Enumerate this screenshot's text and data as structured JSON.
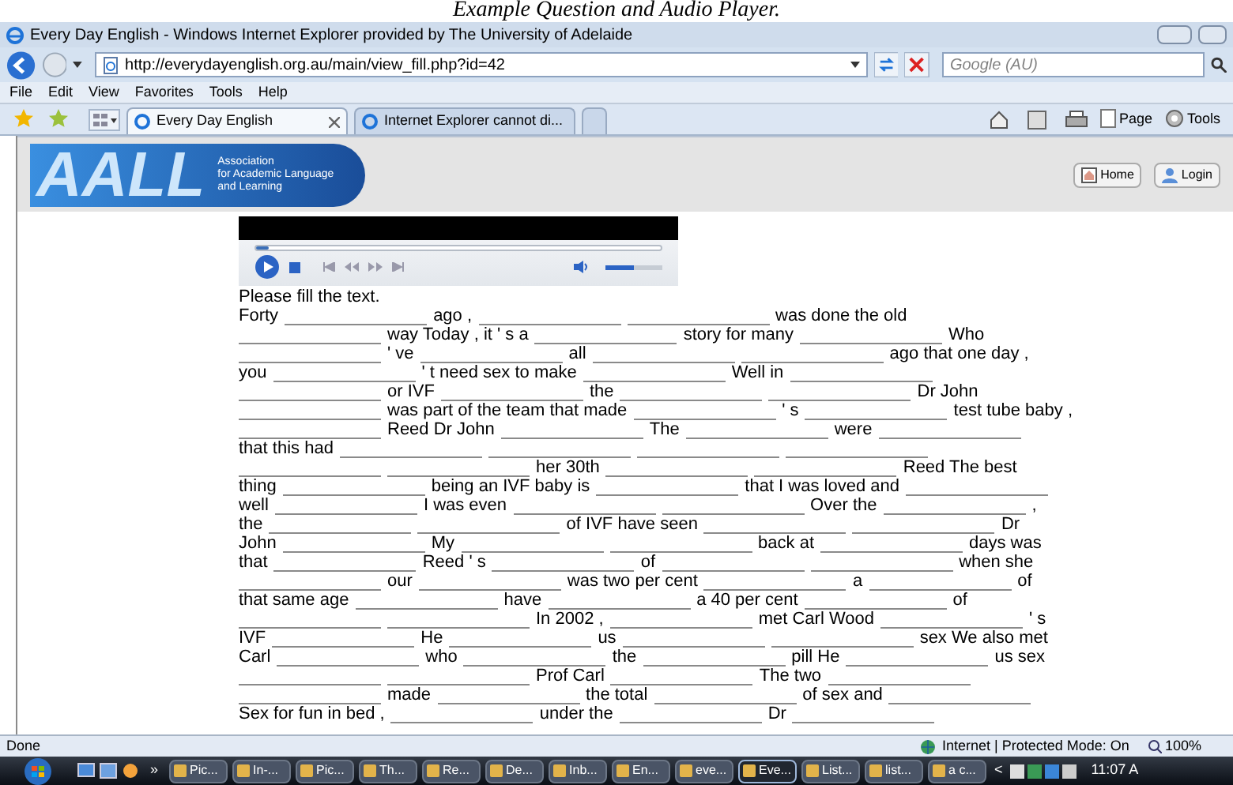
{
  "caption": "Example Question and Audio Player.",
  "window": {
    "title": "Every Day English - Windows Internet Explorer provided by The University of Adelaide"
  },
  "address_bar": {
    "url": "http://everydayenglish.org.au/main/view_fill.php?id=42"
  },
  "search": {
    "placeholder": "Google (AU)"
  },
  "menu": [
    "File",
    "Edit",
    "View",
    "Favorites",
    "Tools",
    "Help"
  ],
  "tabs": [
    {
      "label": "Every Day English",
      "selected": true
    },
    {
      "label": "Internet Explorer cannot di...",
      "selected": false
    }
  ],
  "command_bar": [
    "Page",
    "Tools"
  ],
  "header": {
    "logo": "AALL",
    "logo_lines": [
      "Association",
      "for Academic Language",
      "and Learning"
    ],
    "buttons": [
      "Home",
      "Login"
    ]
  },
  "player": {
    "seek": {
      "level": 0.02
    },
    "volume": {
      "level": 0.5
    }
  },
  "instruction": "Please fill the text.",
  "passage": [
    [
      {
        "kind": "text",
        "text": "Forty"
      },
      {
        "kind": "blank"
      },
      {
        "kind": "text",
        "text": "ago ,"
      },
      {
        "kind": "blank"
      },
      {
        "kind": "blank"
      },
      {
        "kind": "text",
        "text": "was done the old"
      }
    ],
    [
      {
        "kind": "blank"
      },
      {
        "kind": "text",
        "text": "way Today , it ' s a"
      },
      {
        "kind": "blank"
      },
      {
        "kind": "text",
        "text": "story for many"
      },
      {
        "kind": "blank"
      },
      {
        "kind": "text",
        "text": "Who"
      }
    ],
    [
      {
        "kind": "blank"
      },
      {
        "kind": "text",
        "text": "' ve"
      },
      {
        "kind": "blank"
      },
      {
        "kind": "text",
        "text": "all"
      },
      {
        "kind": "blank"
      },
      {
        "kind": "blank"
      },
      {
        "kind": "text",
        "text": "ago that one day ,"
      }
    ],
    [
      {
        "kind": "text",
        "text": "you"
      },
      {
        "kind": "blank"
      },
      {
        "kind": "text",
        "text": "' t need sex to make"
      },
      {
        "kind": "blank"
      },
      {
        "kind": "text",
        "text": "Well in"
      },
      {
        "kind": "blank"
      }
    ],
    [
      {
        "kind": "blank"
      },
      {
        "kind": "text",
        "text": "or IVF"
      },
      {
        "kind": "blank"
      },
      {
        "kind": "text",
        "text": "the"
      },
      {
        "kind": "blank"
      },
      {
        "kind": "blank"
      },
      {
        "kind": "text",
        "text": "Dr John"
      }
    ],
    [
      {
        "kind": "blank"
      },
      {
        "kind": "text",
        "text": "was part of the team that made"
      },
      {
        "kind": "blank"
      },
      {
        "kind": "text",
        "text": "' s"
      },
      {
        "kind": "blank"
      },
      {
        "kind": "text",
        "text": "test tube baby ,"
      }
    ],
    [
      {
        "kind": "blank"
      },
      {
        "kind": "text",
        "text": "Reed Dr John"
      },
      {
        "kind": "blank"
      },
      {
        "kind": "text",
        "text": "The"
      },
      {
        "kind": "blank"
      },
      {
        "kind": "text",
        "text": "were"
      },
      {
        "kind": "blank"
      }
    ],
    [
      {
        "kind": "text",
        "text": "that this had"
      },
      {
        "kind": "blank"
      },
      {
        "kind": "blank"
      },
      {
        "kind": "blank"
      },
      {
        "kind": "blank"
      }
    ],
    [
      {
        "kind": "blank"
      },
      {
        "kind": "blank"
      },
      {
        "kind": "text",
        "text": "her 30th"
      },
      {
        "kind": "blank"
      },
      {
        "kind": "blank"
      },
      {
        "kind": "text",
        "text": "Reed The best"
      }
    ],
    [
      {
        "kind": "text",
        "text": "thing"
      },
      {
        "kind": "blank"
      },
      {
        "kind": "text",
        "text": "being an IVF baby is"
      },
      {
        "kind": "blank"
      },
      {
        "kind": "text",
        "text": "that I was loved and"
      },
      {
        "kind": "blank"
      }
    ],
    [
      {
        "kind": "text",
        "text": "well"
      },
      {
        "kind": "blank"
      },
      {
        "kind": "text",
        "text": "I was even"
      },
      {
        "kind": "blank"
      },
      {
        "kind": "blank"
      },
      {
        "kind": "text",
        "text": "Over the"
      },
      {
        "kind": "blank"
      },
      {
        "kind": "text",
        "text": ","
      }
    ],
    [
      {
        "kind": "text",
        "text": "the"
      },
      {
        "kind": "blank"
      },
      {
        "kind": "blank"
      },
      {
        "kind": "text",
        "text": "of IVF have seen"
      },
      {
        "kind": "blank"
      },
      {
        "kind": "blank"
      },
      {
        "kind": "text",
        "text": "Dr"
      }
    ],
    [
      {
        "kind": "text",
        "text": "John"
      },
      {
        "kind": "blank"
      },
      {
        "kind": "text",
        "text": "My"
      },
      {
        "kind": "blank"
      },
      {
        "kind": "blank"
      },
      {
        "kind": "text",
        "text": "back at"
      },
      {
        "kind": "blank"
      },
      {
        "kind": "text",
        "text": "days was"
      }
    ],
    [
      {
        "kind": "text",
        "text": "that"
      },
      {
        "kind": "blank"
      },
      {
        "kind": "text",
        "text": "Reed ' s"
      },
      {
        "kind": "blank"
      },
      {
        "kind": "text",
        "text": "of"
      },
      {
        "kind": "blank"
      },
      {
        "kind": "blank"
      },
      {
        "kind": "text",
        "text": "when she"
      }
    ],
    [
      {
        "kind": "blank"
      },
      {
        "kind": "text",
        "text": "our"
      },
      {
        "kind": "blank"
      },
      {
        "kind": "text",
        "text": "was two per cent"
      },
      {
        "kind": "blank"
      },
      {
        "kind": "text",
        "text": "a"
      },
      {
        "kind": "blank"
      },
      {
        "kind": "text",
        "text": "of"
      }
    ],
    [
      {
        "kind": "text",
        "text": "that same age"
      },
      {
        "kind": "blank"
      },
      {
        "kind": "text",
        "text": "have"
      },
      {
        "kind": "blank"
      },
      {
        "kind": "text",
        "text": "a 40 per cent"
      },
      {
        "kind": "blank"
      },
      {
        "kind": "text",
        "text": "of"
      }
    ],
    [
      {
        "kind": "blank"
      },
      {
        "kind": "blank"
      },
      {
        "kind": "text",
        "text": "In 2002 ,"
      },
      {
        "kind": "blank"
      },
      {
        "kind": "text",
        "text": "met Carl Wood"
      },
      {
        "kind": "blank"
      },
      {
        "kind": "text",
        "text": "' s"
      }
    ],
    [
      {
        "kind": "text",
        "text": "IVF"
      },
      {
        "kind": "blank"
      },
      {
        "kind": "text",
        "text": "He"
      },
      {
        "kind": "blank"
      },
      {
        "kind": "text",
        "text": "us"
      },
      {
        "kind": "blank"
      },
      {
        "kind": "blank"
      },
      {
        "kind": "text",
        "text": "sex We also met"
      }
    ],
    [
      {
        "kind": "text",
        "text": "Carl"
      },
      {
        "kind": "blank"
      },
      {
        "kind": "text",
        "text": "who"
      },
      {
        "kind": "blank"
      },
      {
        "kind": "text",
        "text": "the"
      },
      {
        "kind": "blank"
      },
      {
        "kind": "text",
        "text": "pill He"
      },
      {
        "kind": "blank"
      },
      {
        "kind": "text",
        "text": "us sex"
      }
    ],
    [
      {
        "kind": "blank"
      },
      {
        "kind": "blank"
      },
      {
        "kind": "text",
        "text": "Prof Carl"
      },
      {
        "kind": "blank"
      },
      {
        "kind": "text",
        "text": "The two"
      },
      {
        "kind": "blank"
      }
    ],
    [
      {
        "kind": "blank"
      },
      {
        "kind": "text",
        "text": "made"
      },
      {
        "kind": "blank"
      },
      {
        "kind": "text",
        "text": "the total"
      },
      {
        "kind": "blank"
      },
      {
        "kind": "text",
        "text": "of sex and"
      },
      {
        "kind": "blank"
      }
    ],
    [
      {
        "kind": "text",
        "text": "Sex for fun in bed ,"
      },
      {
        "kind": "blank"
      },
      {
        "kind": "text",
        "text": "under the"
      },
      {
        "kind": "blank"
      },
      {
        "kind": "text",
        "text": "Dr"
      },
      {
        "kind": "blank"
      }
    ]
  ],
  "status_bar": {
    "status": "Done",
    "zone": "Internet | Protected Mode: On",
    "zoom": "100%"
  },
  "taskbar": {
    "more": "»",
    "items": [
      {
        "label": "Pic...",
        "selected": false
      },
      {
        "label": "In-...",
        "selected": false
      },
      {
        "label": "Pic...",
        "selected": false
      },
      {
        "label": "Th...",
        "selected": false
      },
      {
        "label": "Re...",
        "selected": false
      },
      {
        "label": "De...",
        "selected": false
      },
      {
        "label": "Inb...",
        "selected": false
      },
      {
        "label": "En...",
        "selected": false
      },
      {
        "label": "eve...",
        "selected": false
      },
      {
        "label": "Eve...",
        "selected": true
      },
      {
        "label": "List...",
        "selected": false
      },
      {
        "label": "list...",
        "selected": false
      },
      {
        "label": "a c...",
        "selected": false
      }
    ],
    "scroll": "<",
    "clock": "11:07 A"
  }
}
